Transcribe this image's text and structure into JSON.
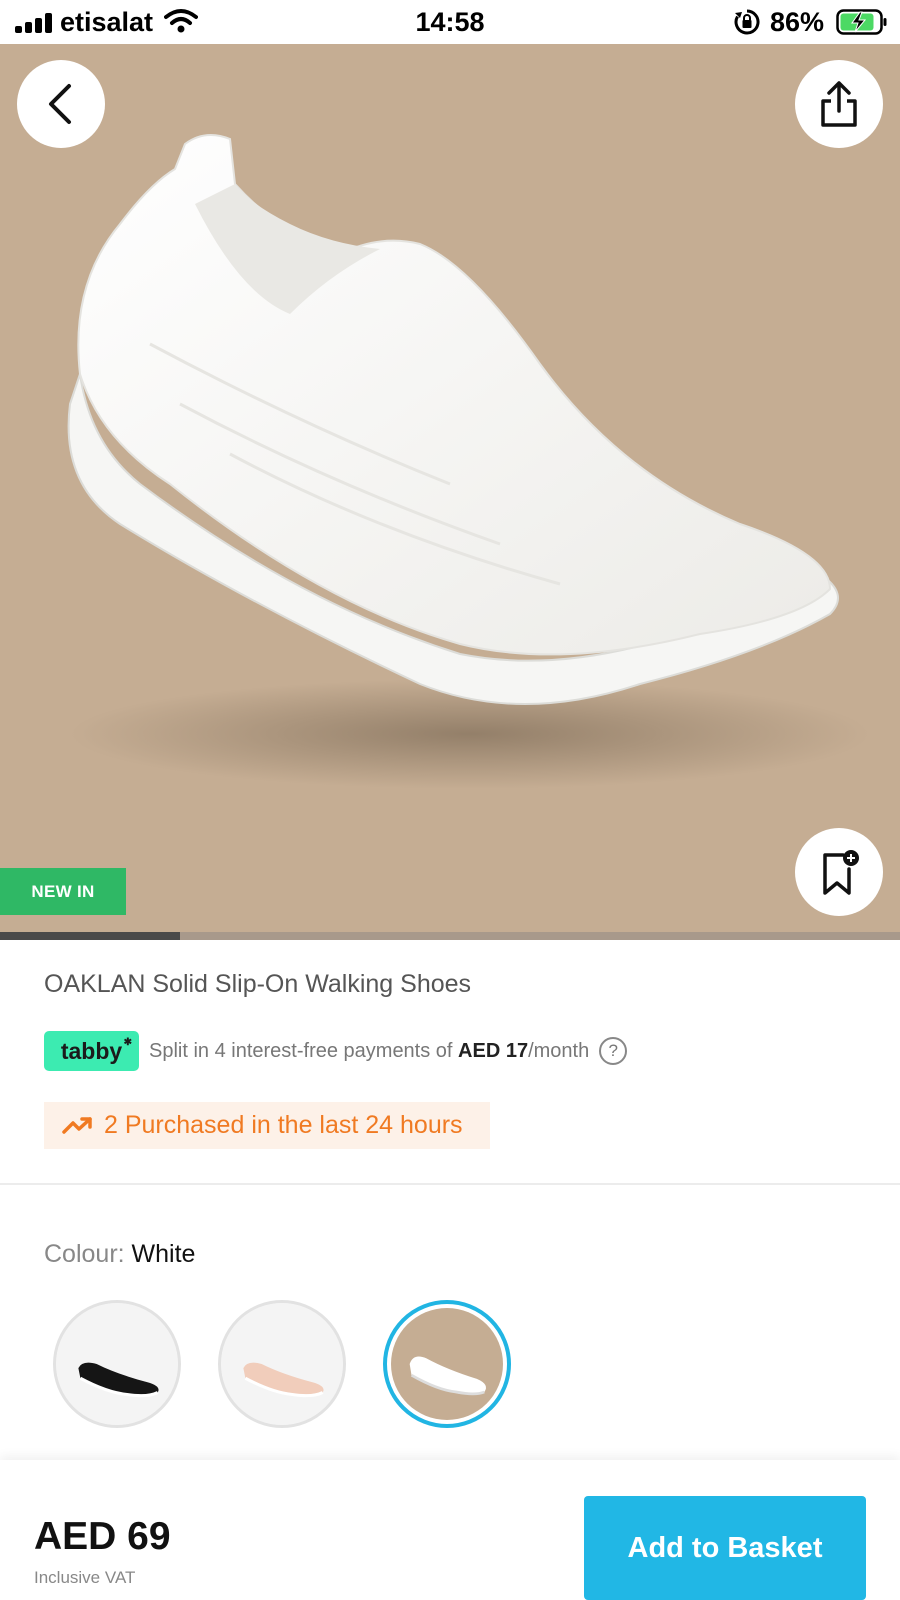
{
  "status_bar": {
    "carrier": "etisalat",
    "time": "14:58",
    "battery_percent": "86%"
  },
  "product": {
    "badge": "NEW IN",
    "title": "OAKLAN Solid Slip-On Walking Shoes",
    "image_progress": 0.2
  },
  "tabby": {
    "logo": "tabby",
    "text_prefix": "Split in 4 interest-free payments of ",
    "amount": "AED 17",
    "suffix": "/month",
    "help": "?"
  },
  "social_proof": {
    "text": "2 Purchased in the last 24 hours",
    "icon": "trending-up-icon"
  },
  "colour": {
    "label": "Colour:",
    "value": "White",
    "swatches": [
      {
        "name": "black",
        "color": "#1a1a1a",
        "selected": false
      },
      {
        "name": "pink",
        "color": "#f1cdbb",
        "selected": false
      },
      {
        "name": "white",
        "color": "#ffffff",
        "selected": true
      }
    ]
  },
  "footer": {
    "price": "AED 69",
    "vat_note": "Inclusive VAT",
    "add_button": "Add to Basket"
  },
  "colors": {
    "accent": "#21b7e5",
    "hero_background": "#c5ad93",
    "new_badge": "#2fb865",
    "tabby": "#3cebb1",
    "social_proof_text": "#f07a22",
    "social_proof_bg": "#fdf1e8"
  }
}
